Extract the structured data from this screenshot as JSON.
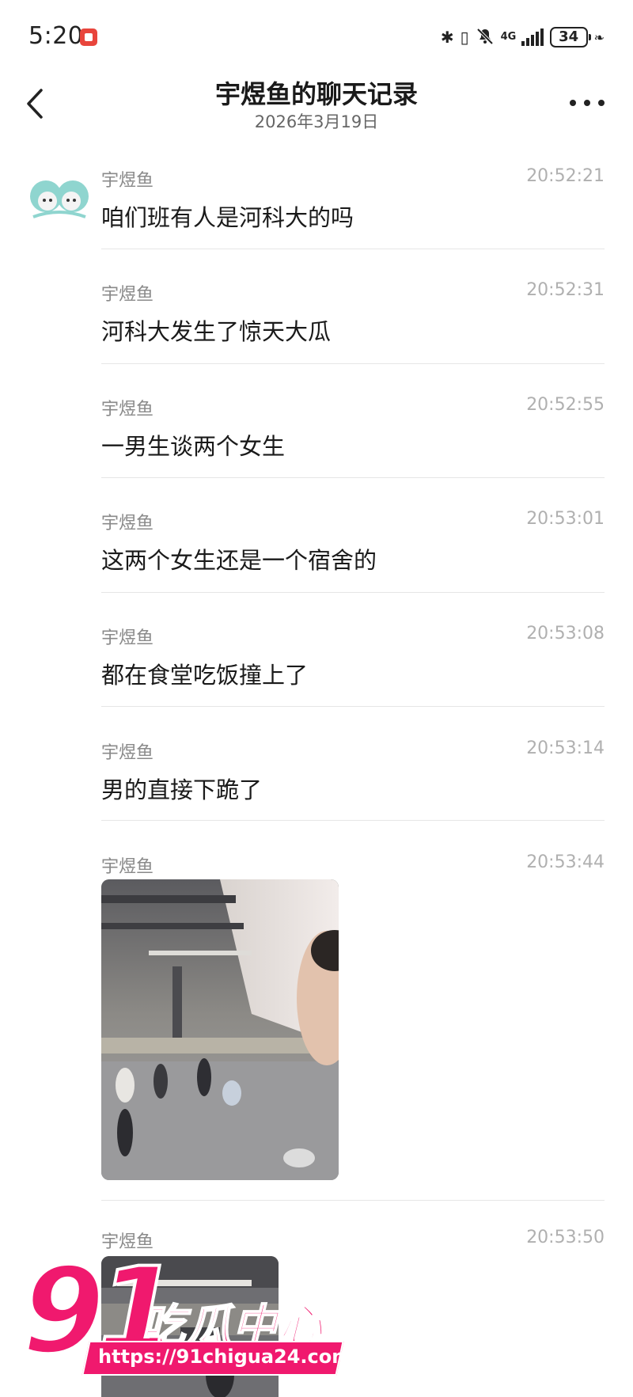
{
  "status_bar": {
    "time": "5:20",
    "network": "4G",
    "battery": "34"
  },
  "header": {
    "title": "宇煜鱼的聊天记录",
    "date": "2026年3月19日"
  },
  "messages": [
    {
      "sender": "宇煜鱼",
      "time": "20:52:21",
      "text": "咱们班有人是河科大的吗"
    },
    {
      "sender": "宇煜鱼",
      "time": "20:52:31",
      "text": "河科大发生了惊天大瓜"
    },
    {
      "sender": "宇煜鱼",
      "time": "20:52:55",
      "text": "一男生谈两个女生"
    },
    {
      "sender": "宇煜鱼",
      "time": "20:53:01",
      "text": "这两个女生还是一个宿舍的"
    },
    {
      "sender": "宇煜鱼",
      "time": "20:53:08",
      "text": "都在食堂吃饭撞上了"
    },
    {
      "sender": "宇煜鱼",
      "time": "20:53:14",
      "text": "男的直接下跪了"
    },
    {
      "sender": "宇煜鱼",
      "time": "20:53:44",
      "text": ""
    },
    {
      "sender": "宇煜鱼",
      "time": "20:53:50",
      "text": ""
    }
  ],
  "watermark": {
    "number": "91",
    "brand": "吃瓜中心",
    "url": "https://91chigua24.com"
  }
}
